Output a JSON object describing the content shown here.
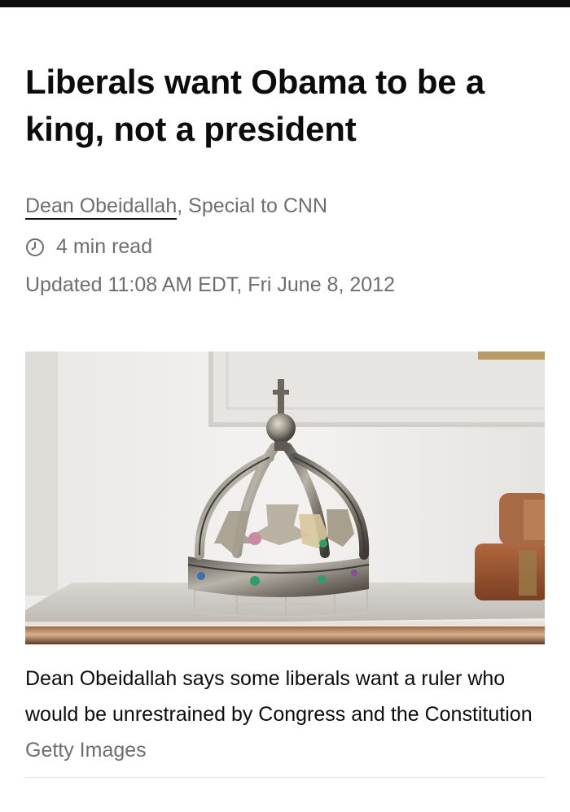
{
  "article": {
    "headline": "Liberals want Obama to be a king, not a president",
    "author": "Dean Obeidallah",
    "author_suffix": ", Special to CNN",
    "read_time": "4 min read",
    "updated": "Updated 11:08 AM EDT, Fri June 8, 2012"
  },
  "photo": {
    "caption": "Dean Obeidallah says some liberals want a ruler who would be unrestrained by Congress and the Constitution",
    "credit": "Getty Images"
  },
  "icons": {
    "read_time_icon": "clock-icon"
  },
  "colors": {
    "text": "#0c0c0c",
    "muted": "#6e6e6e",
    "top_bar": "#0c0c0c"
  }
}
